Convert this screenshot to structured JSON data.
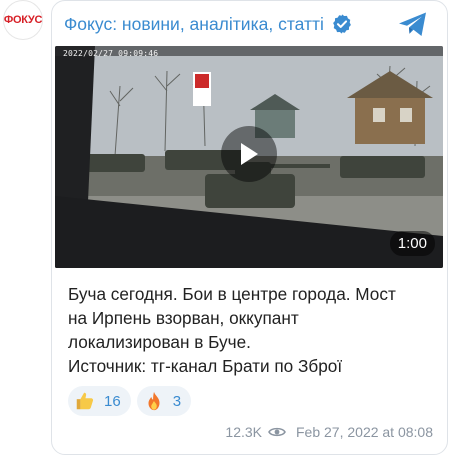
{
  "avatar": {
    "text": "ФОКУС",
    "color": "#d71f26"
  },
  "header": {
    "channel_title": "Фокус: новини, аналітика, статті",
    "verified_icon": "verified-badge-icon",
    "telegram_icon": "telegram-logo-icon",
    "accent_color": "#3a8bd0"
  },
  "video": {
    "timestamp_overlay": "2022/02/27 09:09:46",
    "duration": "1:00",
    "play_icon": "play-icon"
  },
  "post": {
    "lines": [
      "Буча сегодня. Бои в центре города. Мост",
      "на Ирпень взорван, оккупант",
      "локализирован в Буче.",
      "Источник: тг-канал Брати по Зброї"
    ]
  },
  "reactions": [
    {
      "emoji": "thumbs-up-icon",
      "count": "16"
    },
    {
      "emoji": "fire-icon",
      "count": "3"
    }
  ],
  "footer": {
    "views": "12.3K",
    "eye_icon": "eye-icon",
    "date": "Feb 27, 2022 at 08:08"
  }
}
